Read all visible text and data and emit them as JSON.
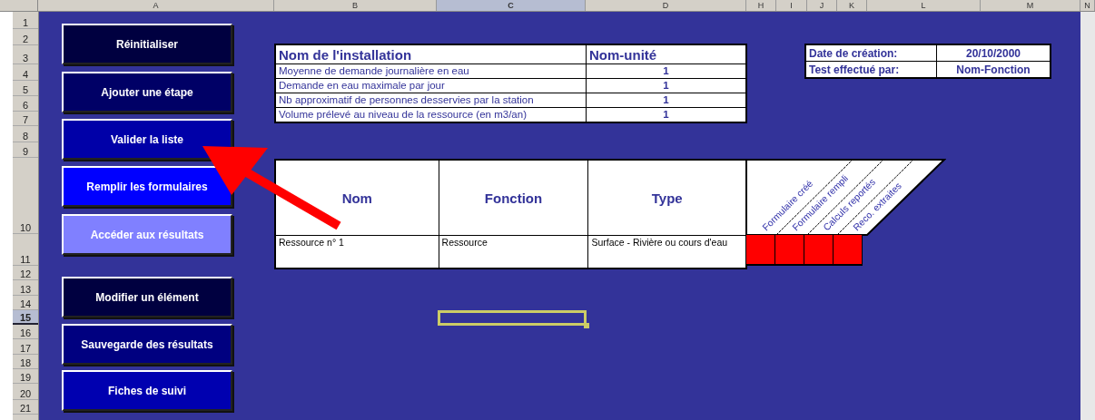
{
  "column_headers": [
    {
      "label": "A",
      "selected": false
    },
    {
      "label": "B",
      "selected": false
    },
    {
      "label": "C",
      "selected": true
    },
    {
      "label": "D",
      "selected": false
    },
    {
      "label": "H",
      "selected": false
    },
    {
      "label": "I",
      "selected": false
    },
    {
      "label": "J",
      "selected": false
    },
    {
      "label": "K",
      "selected": false
    },
    {
      "label": "L",
      "selected": false
    },
    {
      "label": "M",
      "selected": false
    },
    {
      "label": "N",
      "selected": false
    }
  ],
  "row_headers": [
    {
      "label": "1",
      "selected": false
    },
    {
      "label": "2",
      "selected": false
    },
    {
      "label": "3",
      "selected": false
    },
    {
      "label": "4",
      "selected": false
    },
    {
      "label": "5",
      "selected": false
    },
    {
      "label": "6",
      "selected": false
    },
    {
      "label": "7",
      "selected": false
    },
    {
      "label": "8",
      "selected": false
    },
    {
      "label": "9",
      "selected": false
    },
    {
      "label": "10",
      "selected": false
    },
    {
      "label": "11",
      "selected": false
    },
    {
      "label": "12",
      "selected": false
    },
    {
      "label": "13",
      "selected": false
    },
    {
      "label": "14",
      "selected": false
    },
    {
      "label": "15",
      "selected": true
    },
    {
      "label": "16",
      "selected": false
    },
    {
      "label": "17",
      "selected": false
    },
    {
      "label": "18",
      "selected": false
    },
    {
      "label": "19",
      "selected": false
    },
    {
      "label": "20",
      "selected": false
    },
    {
      "label": "21",
      "selected": false
    }
  ],
  "buttons": [
    {
      "label": "Réinitialiser",
      "color": "#000040"
    },
    {
      "label": "Ajouter une étape",
      "color": "#000066"
    },
    {
      "label": "Valider la liste",
      "color": "#0000a8"
    },
    {
      "label": "Remplir les formulaires",
      "color": "#0000ff"
    },
    {
      "label": "Accéder aux résultats",
      "color": "#8080ff"
    },
    {
      "label": "Modifier un élément",
      "color": "#000040"
    },
    {
      "label": "Sauvegarde des résultats",
      "color": "#000080"
    },
    {
      "label": "Fiches de suivi",
      "color": "#0000b0"
    }
  ],
  "installation_table": {
    "header": [
      "Nom de l'installation",
      "Nom-unité"
    ],
    "rows": [
      {
        "label": "Moyenne de demande journalière en eau",
        "value": "1"
      },
      {
        "label": "Demande en eau maximale par jour",
        "value": "1"
      },
      {
        "label": "Nb approximatif de personnes desservies par la station",
        "value": "1"
      },
      {
        "label": "Volume prélevé au niveau de la ressource (en m3/an)",
        "value": "1"
      }
    ]
  },
  "info_table": {
    "rows": [
      {
        "label": "Date de création:",
        "value": "20/10/2000"
      },
      {
        "label": "Test effectué par:",
        "value": "Nom-Fonction"
      }
    ]
  },
  "elements_table": {
    "columns": [
      "Nom",
      "Fonction",
      "Type"
    ],
    "status_columns": [
      "Formulaire créé",
      "Formulaire rempli",
      "Calculs reportés",
      "Reco. extraites"
    ],
    "rows": [
      {
        "cells": [
          "Ressource n° 1",
          "Ressource",
          "Surface - Rivière ou cours d'eau"
        ],
        "status": [
          {
            "color": "#ff0000"
          },
          {
            "color": "#ff0000"
          },
          {
            "color": "#ff0000"
          },
          {
            "color": "#ff0000"
          }
        ]
      }
    ]
  }
}
